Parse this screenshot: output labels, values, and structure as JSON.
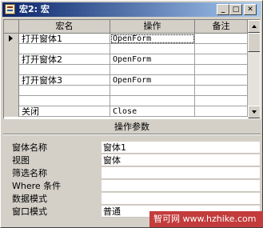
{
  "window": {
    "title": "宏2: 宏"
  },
  "title_buttons": {
    "minimize": "_",
    "maximize": "□",
    "close": "✕"
  },
  "grid": {
    "headers": {
      "name": "宏名",
      "action": "操作",
      "note": "备注"
    },
    "rows": [
      {
        "name": "打开窗体1",
        "action": "OpenForm",
        "note": ""
      },
      {
        "name": "",
        "action": "",
        "note": ""
      },
      {
        "name": "打开窗体2",
        "action": "OpenForm",
        "note": ""
      },
      {
        "name": "",
        "action": "",
        "note": ""
      },
      {
        "name": "打开窗体3",
        "action": "OpenForm",
        "note": ""
      },
      {
        "name": "",
        "action": "",
        "note": ""
      },
      {
        "name": "",
        "action": "",
        "note": ""
      },
      {
        "name": "关闭",
        "action": "Close",
        "note": ""
      }
    ]
  },
  "section": {
    "title": "操作参数"
  },
  "properties": [
    {
      "label": "窗体名称",
      "value": "窗体1"
    },
    {
      "label": "视图",
      "value": "窗体"
    },
    {
      "label": "筛选名称",
      "value": ""
    },
    {
      "label": "Where 条件",
      "value": ""
    },
    {
      "label": "数据模式",
      "value": ""
    },
    {
      "label": "窗口模式",
      "value": "普通"
    }
  ],
  "watermark": {
    "text": "智可网 www.hzhike.com"
  }
}
